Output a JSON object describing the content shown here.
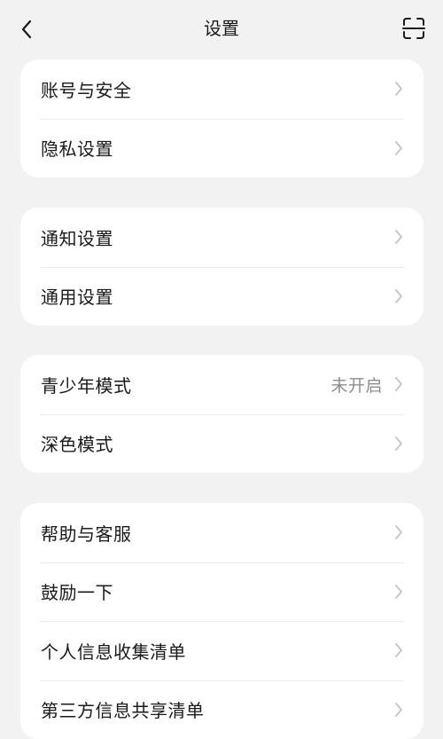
{
  "header": {
    "title": "设置",
    "back_icon": "chevron-left-icon",
    "scan_icon": "scan-icon"
  },
  "groups": [
    {
      "items": [
        {
          "label": "账号与安全"
        },
        {
          "label": "隐私设置"
        }
      ]
    },
    {
      "items": [
        {
          "label": "通知设置"
        },
        {
          "label": "通用设置"
        }
      ]
    },
    {
      "items": [
        {
          "label": "青少年模式",
          "value": "未开启"
        },
        {
          "label": "深色模式"
        }
      ]
    },
    {
      "items": [
        {
          "label": "帮助与客服"
        },
        {
          "label": "鼓励一下"
        },
        {
          "label": "个人信息收集清单"
        },
        {
          "label": "第三方信息共享清单"
        }
      ]
    }
  ],
  "colors": {
    "background": "#f2f2f2",
    "card": "#ffffff",
    "text": "#1a1a1a",
    "secondary_text": "#8e8e8e",
    "chevron": "#c4c4c4"
  }
}
